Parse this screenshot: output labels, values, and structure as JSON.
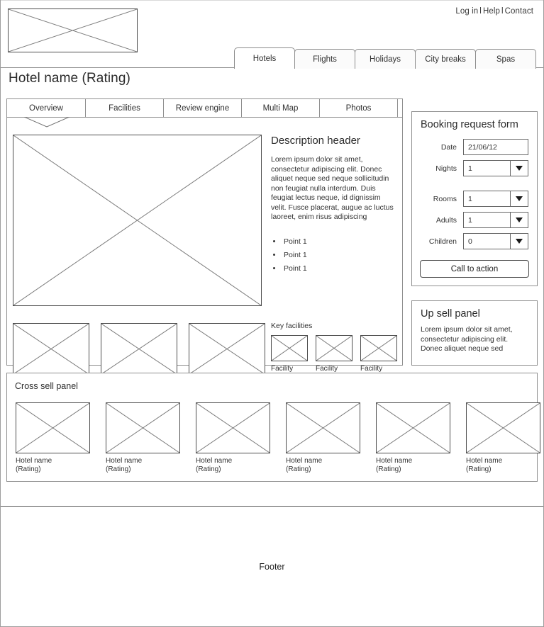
{
  "utility": {
    "links": [
      "Log in",
      "Help",
      "Contact"
    ],
    "separator": "l"
  },
  "logo": {
    "alt": "logo-placeholder"
  },
  "primary_tabs": [
    {
      "label": "Hotels",
      "active": true
    },
    {
      "label": "Flights",
      "active": false
    },
    {
      "label": "Holidays",
      "active": false
    },
    {
      "label": "City breaks",
      "active": false
    },
    {
      "label": "Spas",
      "active": false
    }
  ],
  "page_title": "Hotel name (Rating)",
  "sub_tabs": [
    {
      "label": "Overview",
      "active": true
    },
    {
      "label": "Facilities",
      "active": false
    },
    {
      "label": "Review engine",
      "active": false
    },
    {
      "label": "Multi Map",
      "active": false
    },
    {
      "label": "Photos",
      "active": false
    }
  ],
  "description": {
    "header": "Description header",
    "body": "Lorem ipsum dolor sit amet, consectetur adipiscing elit. Donec aliquet neque sed neque sollicitudin non feugiat nulla interdum. Duis feugiat lectus neque, id dignissim velit. Fusce placerat, augue ac luctus laoreet, enim risus adipiscing",
    "points": [
      "Point 1",
      "Point 1",
      "Point 1"
    ]
  },
  "key_facilities": {
    "title": "Key facilities",
    "items": [
      {
        "label": "Facility"
      },
      {
        "label": "Facility"
      },
      {
        "label": "Facility"
      }
    ]
  },
  "booking_form": {
    "title": "Booking request form",
    "fields": [
      {
        "label": "Date",
        "value": "21/06/12",
        "type": "text"
      },
      {
        "label": "Nights",
        "value": "1",
        "type": "select"
      },
      {
        "label": "Rooms",
        "value": "1",
        "type": "select"
      },
      {
        "label": "Adults",
        "value": "1",
        "type": "select"
      },
      {
        "label": "Children",
        "value": "0",
        "type": "select"
      }
    ],
    "cta_label": "Call to action"
  },
  "upsell": {
    "title": "Up sell panel",
    "body": "Lorem ipsum dolor sit amet, consectetur adipiscing elit. Donec aliquet neque sed"
  },
  "cross_sell": {
    "title": "Cross sell panel",
    "cards": [
      {
        "name": "Hotel name",
        "rating": "(Rating)"
      },
      {
        "name": "Hotel name",
        "rating": "(Rating)"
      },
      {
        "name": "Hotel name",
        "rating": "(Rating)"
      },
      {
        "name": "Hotel name",
        "rating": "(Rating)"
      },
      {
        "name": "Hotel name",
        "rating": "(Rating)"
      },
      {
        "name": "Hotel name",
        "rating": "(Rating)"
      }
    ]
  },
  "footer": {
    "label": "Footer"
  },
  "colors": {
    "border": "#8f8f8f",
    "placeholder_border": "#4d4d4d",
    "text": "#333333",
    "background": "#ffffff"
  }
}
